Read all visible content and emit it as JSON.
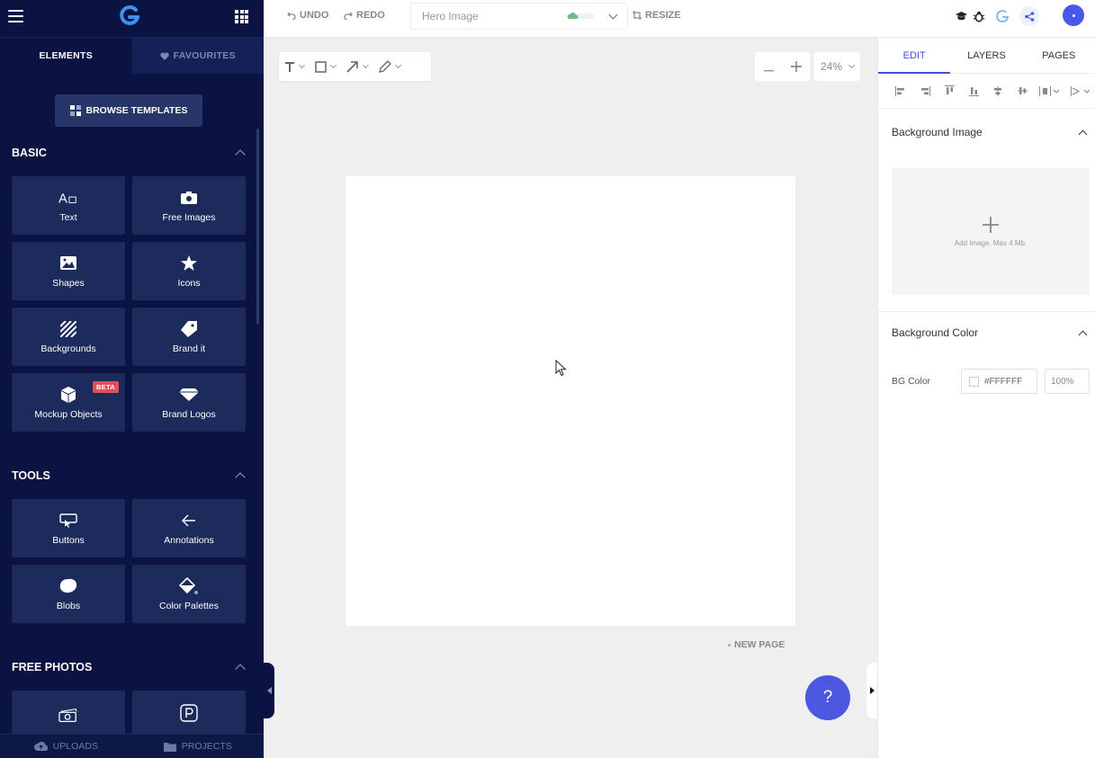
{
  "sidebar": {
    "tabs": [
      {
        "label": "ELEMENTS"
      },
      {
        "label": "FAVOURITES"
      }
    ],
    "browse_templates": "BROWSE TEMPLATES",
    "sections": {
      "basic": {
        "title": "BASIC",
        "items": [
          {
            "label": "Text",
            "icon": "text-icon"
          },
          {
            "label": "Free Images",
            "icon": "camera-icon"
          },
          {
            "label": "Shapes",
            "icon": "image-icon"
          },
          {
            "label": "Icons",
            "icon": "star-icon"
          },
          {
            "label": "Backgrounds",
            "icon": "stripes-icon"
          },
          {
            "label": "Brand it",
            "icon": "tag-icon"
          },
          {
            "label": "Mockup Objects",
            "icon": "cube-icon",
            "badge": "BETA"
          },
          {
            "label": "Brand Logos",
            "icon": "diamond-icon"
          }
        ]
      },
      "tools": {
        "title": "TOOLS",
        "items": [
          {
            "label": "Buttons",
            "icon": "button-cursor-icon"
          },
          {
            "label": "Annotations",
            "icon": "arrow-left-icon"
          },
          {
            "label": "Blobs",
            "icon": "blob-icon"
          },
          {
            "label": "Color Palettes",
            "icon": "paint-bucket-icon"
          }
        ]
      },
      "free_photos": {
        "title": "FREE PHOTOS",
        "items": [
          {
            "label": "",
            "icon": "camera-stack-icon"
          },
          {
            "label": "",
            "icon": "pexels-icon"
          }
        ]
      }
    },
    "bottom": [
      {
        "label": "UPLOADS",
        "icon": "cloud-upload-icon"
      },
      {
        "label": "PROJECTS",
        "icon": "folder-icon"
      }
    ]
  },
  "topbar": {
    "undo": "UNDO",
    "redo": "REDO",
    "document_name": "Hero Image",
    "resize": "RESIZE"
  },
  "canvas": {
    "zoom": "24%",
    "new_page": "NEW PAGE",
    "help": "?"
  },
  "right_panel": {
    "tabs": [
      {
        "label": "EDIT"
      },
      {
        "label": "LAYERS"
      },
      {
        "label": "PAGES"
      }
    ],
    "background_image": {
      "title": "Background Image",
      "hint": "Add Image. Max 4 Mb."
    },
    "background_color": {
      "title": "Background Color",
      "label": "BG Color",
      "hex": "#FFFFFF",
      "opacity": "100%"
    }
  },
  "colors": {
    "sidebar_bg": "#0a1342",
    "tile_bg": "#1d2a5c",
    "accent": "#4d58e0",
    "beta_badge": "#e0505b"
  }
}
